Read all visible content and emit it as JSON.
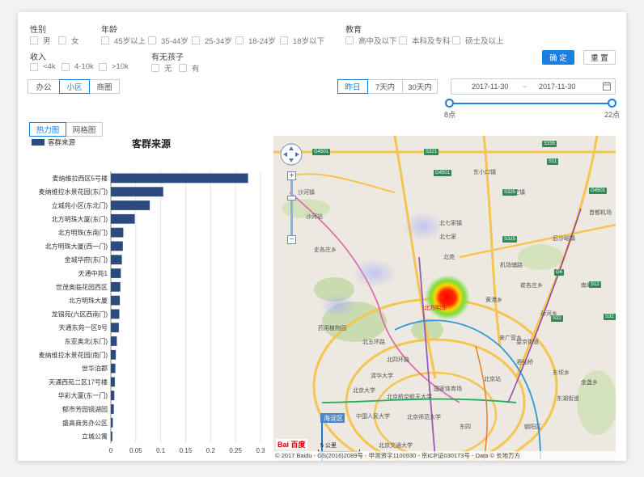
{
  "filters": {
    "gender": {
      "label": "性别",
      "options": [
        "男",
        "女"
      ]
    },
    "age": {
      "label": "年龄",
      "options": [
        "45岁以上",
        "35-44岁",
        "25-34岁",
        "18-24岁",
        "18岁以下"
      ]
    },
    "education": {
      "label": "教育",
      "options": [
        "高中及以下",
        "本科及专科",
        "硕士及以上"
      ]
    },
    "income": {
      "label": "收入",
      "options": [
        "<4k",
        "4-10k",
        ">10k"
      ]
    },
    "children": {
      "label": "有无孩子",
      "options": [
        "无",
        "有"
      ]
    }
  },
  "actions": {
    "confirm": "确 定",
    "reset": "重 置"
  },
  "place_tabs": [
    "办公",
    "小区",
    "商圈"
  ],
  "place_active": 1,
  "time_tabs": [
    "昨日",
    "7天内",
    "30天内"
  ],
  "time_active": 0,
  "date_range": {
    "start": "2017-11-30",
    "sep": "~",
    "end": "2017-11-30"
  },
  "hour_slider": {
    "min_label": "8点",
    "max_label": "22点"
  },
  "view_tabs": [
    "热力图",
    "网格图"
  ],
  "view_active": 0,
  "chart_data": {
    "type": "bar",
    "orientation": "horizontal",
    "title": "客群来源",
    "legend": "客群来源",
    "legend_position": "top-left",
    "categories": [
      "麦纳维拉西区5号楼",
      "麦纳维拉水景花园(东门)",
      "立城苑小区(东北门)",
      "北方明珠大厦(东门)",
      "北方明珠(东南门)",
      "北方明珠大厦(西一门)",
      "金城华府(东门)",
      "天通中苑1",
      "世茂奥临花园西区",
      "北方明珠大厦",
      "龙锦苑(六区西南门)",
      "天通东苑一区9号",
      "东亚奥北(东门)",
      "麦纳维拉水景花园(南门)",
      "世华泊郡",
      "天通西苑二区17号楼",
      "华彩大厦(东一门)",
      "郁市芳园镜湖园",
      "盛高商务办公区",
      "立城公寓"
    ],
    "values": [
      0.275,
      0.105,
      0.078,
      0.048,
      0.025,
      0.024,
      0.022,
      0.02,
      0.019,
      0.018,
      0.017,
      0.016,
      0.012,
      0.01,
      0.009,
      0.008,
      0.007,
      0.006,
      0.004,
      0.003
    ],
    "xticks": [
      "0",
      "0.05",
      "0.1",
      "0.15",
      "0.2",
      "0.25",
      "0.3"
    ],
    "xlim": [
      0,
      0.3
    ],
    "grid": true,
    "bar_color": "#2b4a7d"
  },
  "map": {
    "labels": [
      "沙河镇",
      "沙河站",
      "史各庄乡",
      "北七家镇",
      "东小口镇",
      "北方明珠",
      "黄港乡",
      "来广营乡",
      "药用植物园",
      "北五环路",
      "北四环路",
      "清华大学",
      "北京大学",
      "国家体育场",
      "东坝乡",
      "中国人民大学",
      "北京航空航天大学",
      "海淀区",
      "北京交通大学",
      "北京站",
      "酒仙桥",
      "望京街道",
      "朝阳区",
      "孙河乡",
      "后沙峪镇",
      "北七家",
      "崔各庄乡",
      "金盏乡",
      "首都机场",
      "天竺镇",
      "南皋",
      "机场辅路",
      "北京师范大学",
      "东四",
      "北苑",
      "东湖街道"
    ],
    "shields": [
      "G4501",
      "S321",
      "G4501",
      "S335",
      "S11",
      "S325",
      "G4501",
      "S325",
      "S32",
      "G6",
      "S32",
      "S12"
    ],
    "scale": "5 公里",
    "logo": "Bai 百度",
    "copyright": "© 2017 Baidu - GS(2016)2089号 - 甲测资字1100930 - 京ICP证030173号 - Data © 长地万方"
  }
}
